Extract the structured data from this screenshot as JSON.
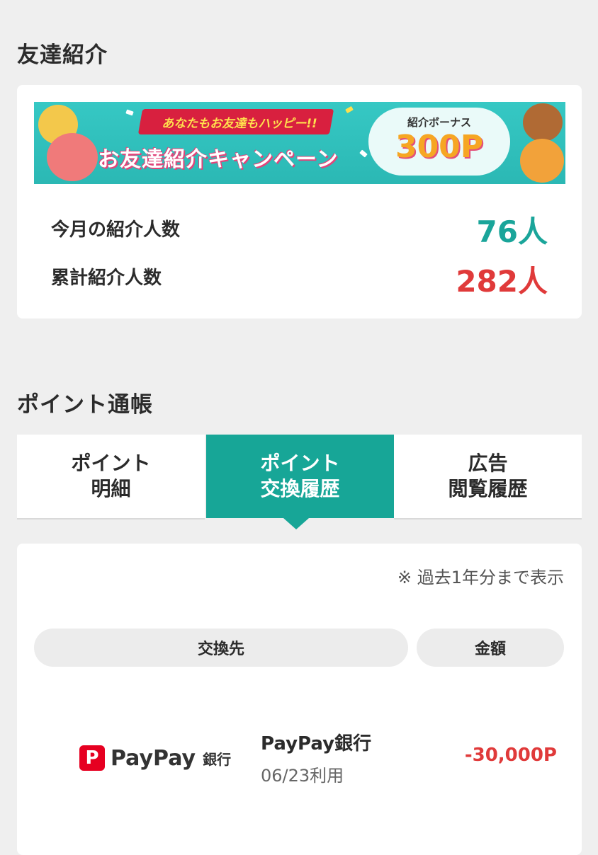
{
  "referral": {
    "title": "友達紹介",
    "banner": {
      "ribbon": "あなたもお友達もハッピー!!",
      "campaign": "お友達紹介キャンペーン",
      "bonus_label": "紹介ボーナス",
      "bonus_value": "300P"
    },
    "monthly_label": "今月の紹介人数",
    "monthly_value": "76人",
    "total_label": "累計紹介人数",
    "total_value": "282人"
  },
  "passbook": {
    "title": "ポイント通帳",
    "tabs": [
      {
        "line1": "ポイント",
        "line2": "明細",
        "active": false
      },
      {
        "line1": "ポイント",
        "line2": "交換履歴",
        "active": true
      },
      {
        "line1": "広告",
        "line2": "閲覧履歴",
        "active": false
      }
    ],
    "note": "※ 過去1年分まで表示",
    "headers": {
      "destination": "交換先",
      "amount": "金額"
    },
    "rows": [
      {
        "logo_text": "PayPay",
        "logo_sub": "銀行",
        "name": "PayPay銀行",
        "date": "06/23利用",
        "amount": "-30,000P"
      }
    ]
  },
  "colors": {
    "teal": "#17a697",
    "stat_teal": "#1aa59a",
    "stat_red": "#e03a3a",
    "banner_bg": "#36c8c4",
    "paypay_red": "#e60021"
  },
  "icons": {
    "banner_mascots": "squirrel-mascot-icon",
    "paypay": "paypay-logo-icon"
  }
}
